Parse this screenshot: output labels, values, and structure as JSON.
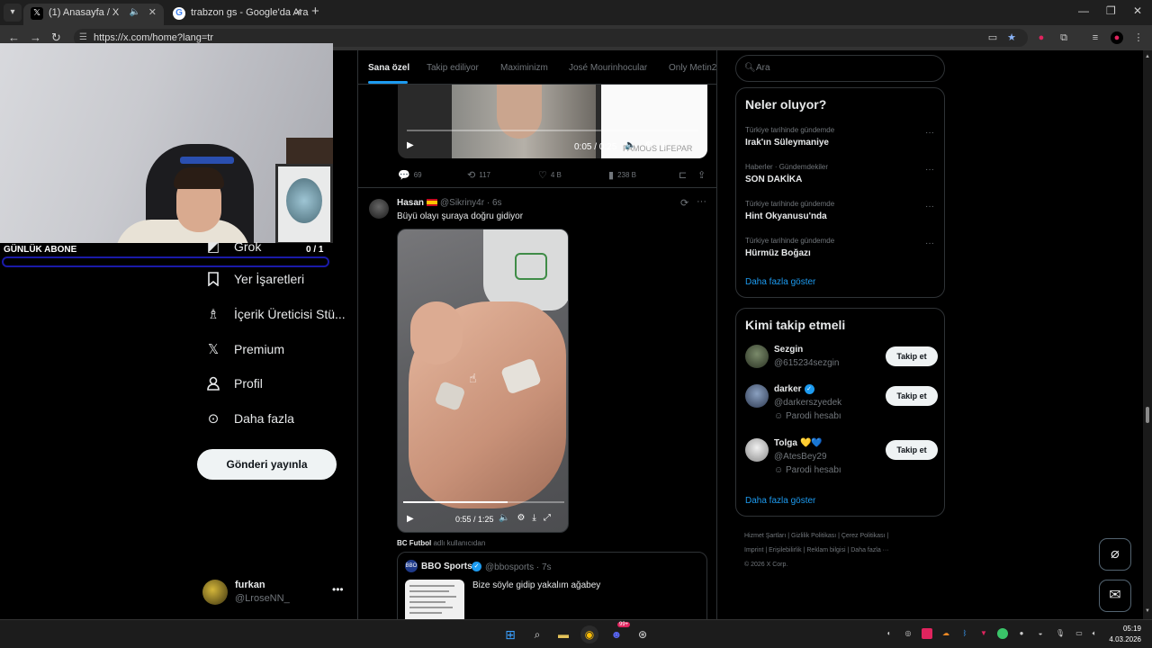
{
  "browser": {
    "tabs": [
      {
        "title": "(1) Anasayfa / X",
        "active": true
      },
      {
        "title": "trabzon gs - Google'da Ara",
        "active": false
      }
    ],
    "url": "https://x.com/home?lang=tr"
  },
  "overlay": {
    "label": "GÜNLÜK ABONE",
    "count": "0  / 1"
  },
  "nav": {
    "items": [
      {
        "label": "Grok",
        "icon": "grok-icon"
      },
      {
        "label": "Yer İşaretleri",
        "icon": "bookmark-icon"
      },
      {
        "label": "İçerik Üreticisi Stü...",
        "icon": "creator-studio-icon"
      },
      {
        "label": "Premium",
        "icon": "x-logo-icon"
      },
      {
        "label": "Profil",
        "icon": "person-icon"
      },
      {
        "label": "Daha fazla",
        "icon": "more-circle-icon"
      }
    ],
    "post_button": "Gönderi yayınla",
    "account": {
      "name": "furkan",
      "handle": "@LroseNN_"
    }
  },
  "feed": {
    "tabs": [
      "Sana özel",
      "Takip ediliyor",
      "Maximinizm",
      "José Mourinhocular",
      "Only Metin2"
    ],
    "post1": {
      "video_time": "0:05 / 0:25",
      "video_watermark": "FAMOUS LIFEPAR",
      "replies": "69",
      "reposts": "117",
      "likes": "4 B",
      "views": "238 B"
    },
    "post2": {
      "name": "Hasan",
      "handle": "@Sikriny4r",
      "time": "6s",
      "text": "Büyü olayı şuraya doğru gidiyor",
      "video_time": "0:55 / 1:25",
      "video_progress": 0.65,
      "quote_context_name": "BC Futbol",
      "quote_context_text": "adlı kullanıcıdan",
      "quote": {
        "name": "BBO Sports",
        "handle": "@bbosports",
        "time": "7s",
        "text": "Bize söyle gidip yakalım ağabey"
      }
    }
  },
  "right": {
    "search_placeholder": "Ara",
    "trends_title": "Neler oluyor?",
    "trends": [
      {
        "category": "Türkiye tarihinde gündemde",
        "name": "Irak'ın Süleymaniye"
      },
      {
        "category": "Haberler · Gündemdekiler",
        "name": "SON DAKİKA"
      },
      {
        "category": "Türkiye tarihinde gündemde",
        "name": "Hint Okyanusu'nda"
      },
      {
        "category": "Türkiye tarihinde gündemde",
        "name": "Hürmüz Boğazı"
      }
    ],
    "trends_more": "Daha fazla göster",
    "follow_title": "Kimi takip etmeli",
    "follow": [
      {
        "name": "Sezgin",
        "handle": "@615234sezgin",
        "tag": "",
        "verified": false,
        "hearts": ""
      },
      {
        "name": "darker",
        "handle": "@darkerszyedek",
        "tag": "Parodi hesabı",
        "verified": true,
        "hearts": ""
      },
      {
        "name": "Tolga",
        "handle": "@AtesBey29",
        "tag": "Parodi hesabı",
        "verified": false,
        "hearts": "💛💙"
      }
    ],
    "follow_button": "Takip et",
    "follow_more": "Daha fazla göster",
    "footer_line1": "Hizmet Şartları  |  Gizlilik Politikası  |  Çerez Politikası  |",
    "footer_line2": "Imprint  |  Erişilebilirlik  |  Reklam bilgisi  |  Daha fazla ···",
    "footer_line3": "© 2026 X Corp."
  },
  "taskbar": {
    "time": "05:19",
    "date": "4.03.2026",
    "discord_badge": "99+"
  }
}
